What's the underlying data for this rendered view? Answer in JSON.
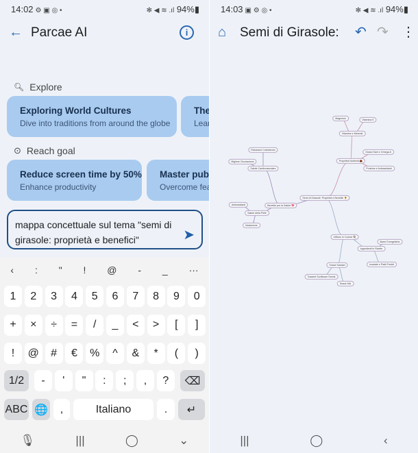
{
  "left": {
    "status": {
      "time": "14:02",
      "icons": [
        "gear-icon",
        "gallery-icon",
        "whatsapp-icon",
        "dot-icon"
      ],
      "battery": "94%"
    },
    "header": {
      "title": "Parcae AI",
      "back_icon": "arrow-left-icon",
      "info_icon": "info-icon"
    },
    "explore": {
      "label": "Explore",
      "cards": [
        {
          "title": "Exploring World Cultures",
          "subtitle": "Dive into traditions from around the globe"
        },
        {
          "title": "The",
          "subtitle": "Lear"
        }
      ]
    },
    "goal": {
      "label": "Reach goal",
      "cards": [
        {
          "title": "Reduce screen time by 50%",
          "subtitle": "Enhance productivity"
        },
        {
          "title": "Master publi",
          "subtitle": "Overcome fear"
        }
      ]
    },
    "input": {
      "value": "mappa concettuale sul tema \"semi di girasole: proprietà e benefici\""
    },
    "keyboard": {
      "suggestions": [
        "‹",
        ":",
        "\"",
        "!",
        "@",
        "-",
        "_",
        "···"
      ],
      "row1": [
        "1",
        "2",
        "3",
        "4",
        "5",
        "6",
        "7",
        "8",
        "9",
        "0"
      ],
      "row2": [
        "+",
        "×",
        "÷",
        "=",
        "/",
        "_",
        "<",
        ">",
        "[",
        "]"
      ],
      "row3": [
        "!",
        "@",
        "#",
        "€",
        "%",
        "^",
        "&",
        "*",
        "(",
        ")"
      ],
      "row4": [
        "1/2",
        "-",
        "'",
        "\"",
        ":",
        ";",
        ",",
        "?",
        "⌫"
      ],
      "row5": {
        "abc": "ABC",
        "globe": "🌐",
        "comma": ",",
        "space": "Italiano",
        "period": ".",
        "enter": "↵"
      }
    },
    "nav": [
      "🎙",
      "|||",
      "◯",
      "⌄"
    ]
  },
  "right": {
    "status": {
      "time": "14:03",
      "battery": "94%"
    },
    "header": {
      "title": "Semi di Girasole:",
      "home_icon": "home-icon",
      "undo_icon": "undo-icon",
      "redo_icon": "redo-icon",
      "menu_icon": "more-vert-icon"
    },
    "mindmap": {
      "nodes": [
        "Semi di Girasole: Proprietà e Benefici 🌻",
        "Proprietà Nutrienti 🌰",
        "Vitamine e Minerali",
        "Magnesio",
        "Vitamina E",
        "Grassi Sani e Omega-6",
        "Proteine e Antiossidanti",
        "Benefici per la Salute 💖",
        "Salute Cardiovascolare",
        "Riduzione Colesterolo",
        "Migliore Circolazione",
        "Salute della Pelle",
        "Antiossidanti",
        "Idratazione",
        "Utilizzo in Cucina 🍳",
        "Ingredienti in Ricette",
        "Barre Energetiche",
        "Insalate e Piatti Freddi",
        "Snack Salutari",
        "Toasted Sunflower Seeds",
        "Snack Mix"
      ]
    },
    "nav": [
      "|||",
      "◯",
      "‹"
    ]
  },
  "colors": {
    "accent": "#2866b0",
    "card": "#a9cbef",
    "background": "#eef2f8"
  }
}
